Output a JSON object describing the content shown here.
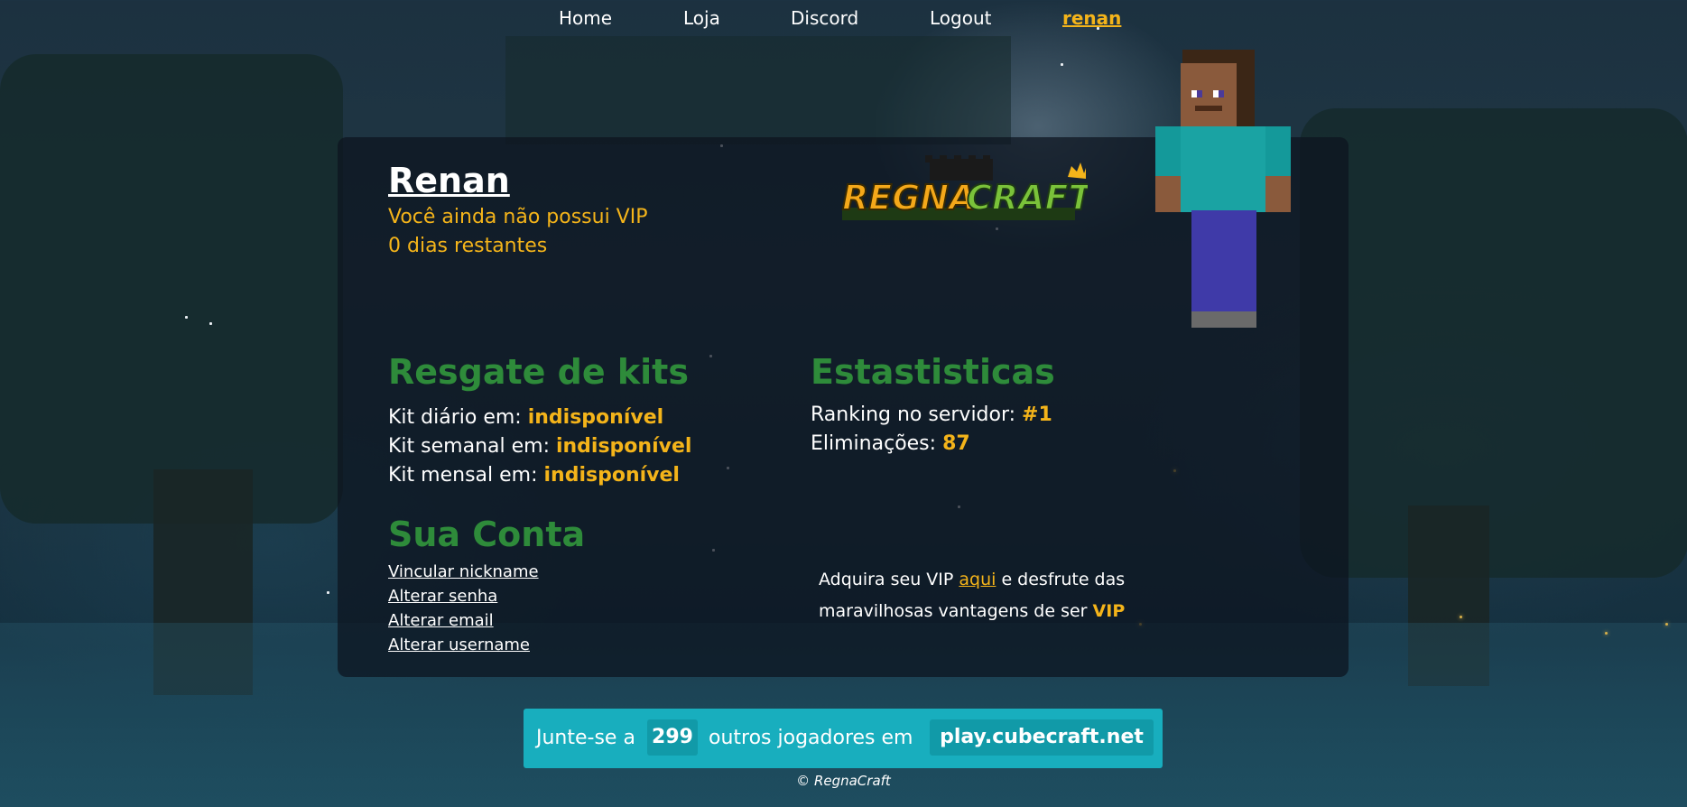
{
  "nav": {
    "items": [
      "Home",
      "Loja",
      "Discord",
      "Logout"
    ],
    "user": "renan"
  },
  "profile": {
    "name": "Renan",
    "vip_status": "Você ainda não possui VIP",
    "days_remaining": "0 dias restantes"
  },
  "logo": {
    "text_left": "REGNA",
    "text_right": "CRAFT"
  },
  "kits": {
    "title": "Resgate de kits",
    "rows": [
      {
        "label": "Kit diário em: ",
        "value": "indisponível"
      },
      {
        "label": "Kit semanal em: ",
        "value": "indisponível"
      },
      {
        "label": "Kit mensal em: ",
        "value": "indisponível"
      }
    ]
  },
  "stats": {
    "title": "Estastisticas",
    "rows": [
      {
        "label": "Ranking no servidor: ",
        "value": "#1"
      },
      {
        "label": "Eliminações: ",
        "value": "87"
      }
    ]
  },
  "account": {
    "title": "Sua Conta",
    "links": [
      "Vincular nickname",
      "Alterar senha",
      "Alterar email",
      "Alterar username"
    ]
  },
  "promo": {
    "before": "Adquira seu VIP ",
    "link": "aqui",
    "middle": " e desfrute das maravilhosas vantagens de ser ",
    "vip": "VIP"
  },
  "join": {
    "prefix": "Junte-se a",
    "count": "299",
    "middle": "outros jogadores em",
    "server": "play.cubecraft.net"
  },
  "footer": "© RegnaCraft",
  "colors": {
    "accent": "#f4b41a",
    "section_green": "#2e8b3a",
    "banner": "#18aebe"
  }
}
